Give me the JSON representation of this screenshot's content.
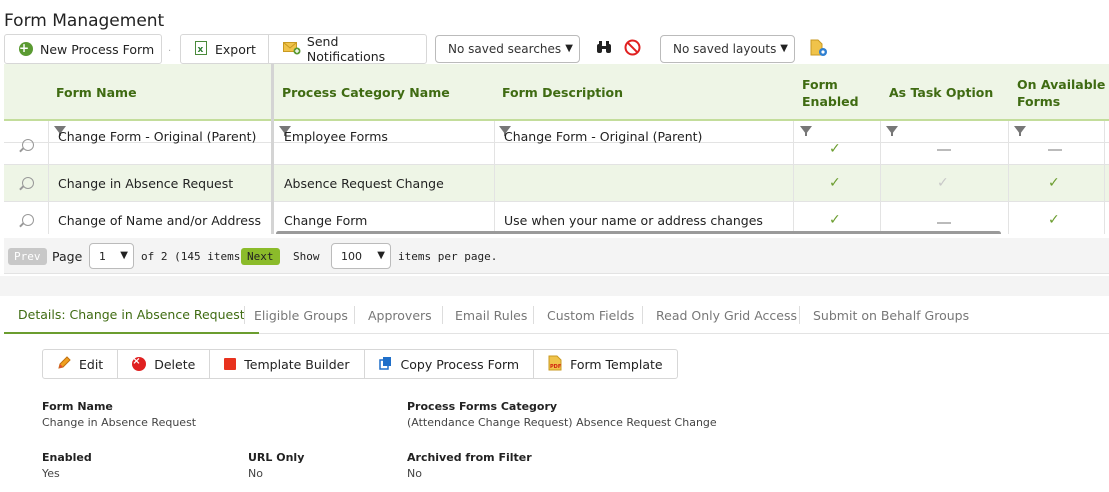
{
  "page_title": "Form Management",
  "toolbar": {
    "new_process_form": "New Process Form",
    "export": "Export",
    "send_notifications": "Send Notifications",
    "saved_searches": "No saved searches",
    "saved_layouts": "No saved layouts"
  },
  "grid": {
    "columns": [
      "Form Name",
      "Process Category Name",
      "Form Description",
      "Form Enabled",
      "As Task Option",
      "On Available Forms"
    ],
    "rows": [
      {
        "form_name": "Change Form - Original (Parent)",
        "category": "Employee Forms",
        "description": "Change Form - Original (Parent)",
        "enabled": true,
        "task_option": false,
        "available": false
      },
      {
        "form_name": "Change in Absence Request",
        "category": "Absence Request Change",
        "description": "",
        "enabled": true,
        "task_option": false,
        "available": true
      },
      {
        "form_name": "Change of Name and/or Address",
        "category": "Change Form",
        "description": "Use when your name or address changes",
        "enabled": true,
        "task_option": false,
        "available": true
      }
    ]
  },
  "pager": {
    "prev": "Prev",
    "page_label": "Page",
    "page_value": "1",
    "of_text": "of 2 (145 items)",
    "next": "Next",
    "show_label": "Show",
    "page_size": "100",
    "items_per_page": "items per page."
  },
  "tabs": [
    "Details: Change in Absence Request",
    "Eligible Groups",
    "Approvers",
    "Email Rules",
    "Custom Fields",
    "Read Only Grid Access",
    "Submit on Behalf Groups"
  ],
  "actions": {
    "edit": "Edit",
    "delete": "Delete",
    "template_builder": "Template Builder",
    "copy_process_form": "Copy Process Form",
    "form_template": "Form Template"
  },
  "details": {
    "form_name_label": "Form Name",
    "form_name_value": "Change in Absence Request",
    "category_label": "Process Forms Category",
    "category_value": "(Attendance Change Request) Absence Request Change",
    "enabled_label": "Enabled",
    "enabled_value": "Yes",
    "url_only_label": "URL Only",
    "url_only_value": "No",
    "archived_label": "Archived from Filter",
    "archived_value": "No"
  },
  "colors": {
    "accent_green": "#6b9d2f",
    "header_bg": "#eef5e6",
    "header_text": "#3f6b12"
  }
}
